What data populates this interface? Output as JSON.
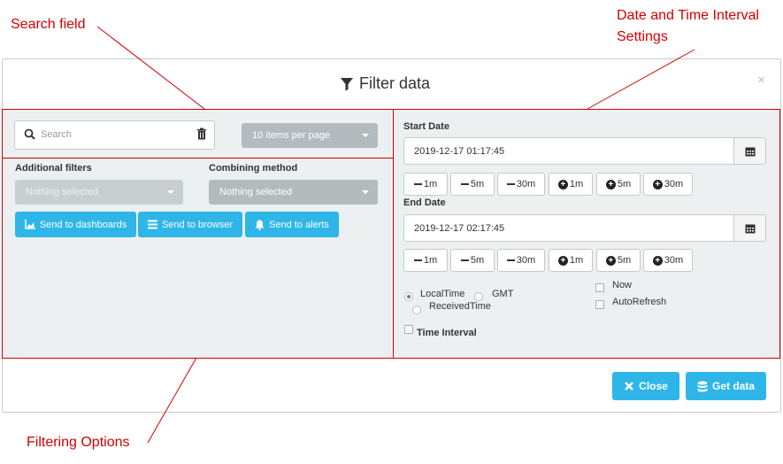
{
  "annotations": {
    "search_field": "Search field",
    "date_time_line1": "Date and Time Interval",
    "date_time_line2": "Settings",
    "filtering_options": "Filtering Options"
  },
  "dialog": {
    "title": "Filter data",
    "title_icon": "filter-icon",
    "close_glyph": "×"
  },
  "left": {
    "search_placeholder": "Search",
    "per_page": "10 items per page",
    "additional_filters_label": "Additional filters",
    "additional_filters_value": "Nothing selected",
    "combining_method_label": "Combining method",
    "combining_method_value": "Nothing selected",
    "send_dashboards": "Send to dashboards",
    "send_browser": "Send to browser",
    "send_alerts": "Send to alerts"
  },
  "right": {
    "start_label": "Start Date",
    "start_value": "2019-12-17 01:17:45",
    "end_label": "End Date",
    "end_value": "2019-12-17 02:17:45",
    "minus_1m": "1m",
    "minus_5m": "5m",
    "minus_30m": "30m",
    "plus_1m": "1m",
    "plus_5m": "5m",
    "plus_30m": "30m",
    "local_time": "LocalTime",
    "gmt": "GMT",
    "received_time": "ReceivedTime",
    "now": "Now",
    "auto_refresh": "AutoRefresh",
    "time_interval": "Time Interval"
  },
  "footer": {
    "close": "Close",
    "get_data": "Get data"
  },
  "colors": {
    "accent": "#2eb6e8",
    "annotation": "#d40000",
    "panel": "#ecf0f1"
  }
}
